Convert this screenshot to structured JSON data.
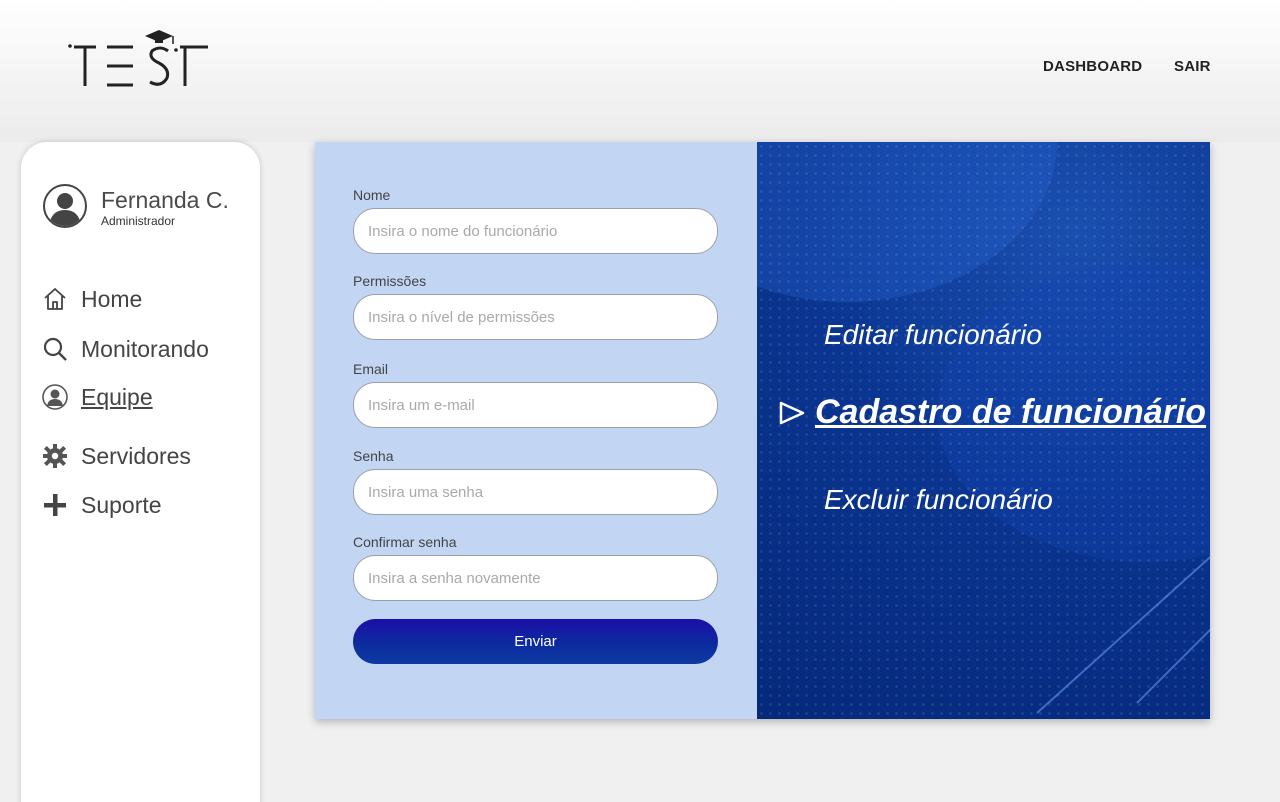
{
  "brand": {
    "logo_text": "TEST"
  },
  "nav": {
    "dashboard": "DASHBOARD",
    "logout": "SAIR"
  },
  "profile": {
    "name": "Fernanda C.",
    "role": "Administrador"
  },
  "sidebar": {
    "items": [
      {
        "label": "Home",
        "icon": "home-icon"
      },
      {
        "label": "Monitorando",
        "icon": "search-icon"
      },
      {
        "label": "Equipe",
        "icon": "user-icon",
        "active": true
      },
      {
        "label": "Servidores",
        "icon": "gear-icon"
      },
      {
        "label": "Suporte",
        "icon": "plus-icon"
      }
    ]
  },
  "form": {
    "fields": [
      {
        "label": "Nome",
        "placeholder": "Insira o nome do funcionário"
      },
      {
        "label": "Permissões",
        "placeholder": "Insira o nível de permissões"
      },
      {
        "label": "Email",
        "placeholder": "Insira um e-mail"
      },
      {
        "label": "Senha",
        "placeholder": "Insira uma senha"
      },
      {
        "label": "Confirmar senha",
        "placeholder": "Insira a senha novamente"
      }
    ],
    "submit_label": "Enviar"
  },
  "actions": {
    "edit": "Editar funcionário",
    "create": "Cadastro de funcionário",
    "delete": "Excluir funcionário"
  },
  "colors": {
    "form_bg": "#c2d6f4",
    "panel_bg": "#0a3591",
    "button": "#1c0fa8"
  }
}
